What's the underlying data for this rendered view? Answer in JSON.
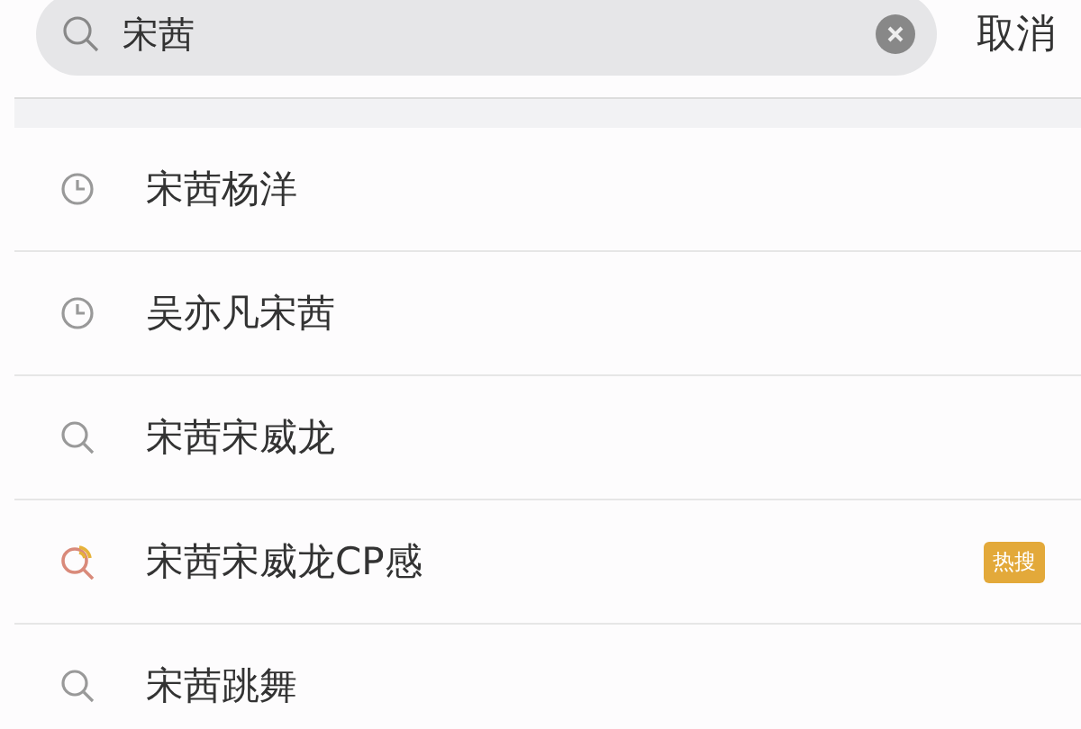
{
  "search": {
    "value": "宋茜"
  },
  "cancel": "取消",
  "suggestions": [
    {
      "kind": "history",
      "text": "宋茜杨洋"
    },
    {
      "kind": "history",
      "text": "吴亦凡宋茜"
    },
    {
      "kind": "search",
      "text": "宋茜宋威龙"
    },
    {
      "kind": "hot",
      "text": "宋茜宋威龙CP感",
      "badge": "热搜"
    },
    {
      "kind": "search",
      "text": "宋茜跳舞"
    }
  ]
}
